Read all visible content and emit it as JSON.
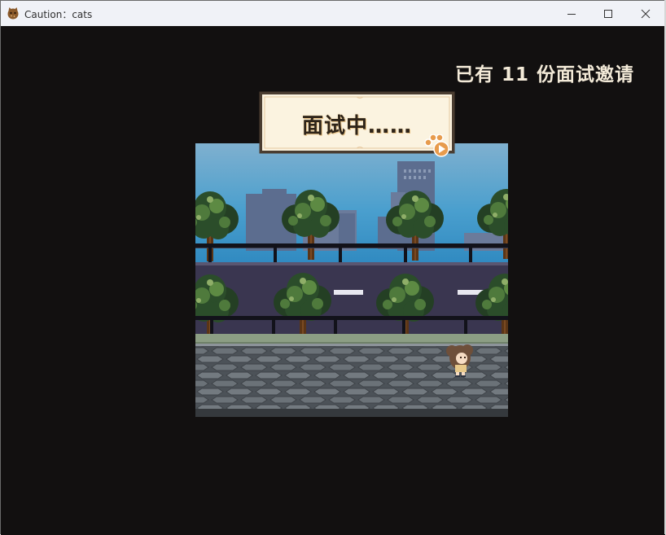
{
  "window": {
    "title": "Caution：cats",
    "app_icon": "cookie-cat-icon",
    "controls": {
      "minimize": "minimize-icon",
      "maximize": "maximize-icon",
      "close": "close-icon"
    }
  },
  "hud": {
    "interview_count_text": "已有 11 份面试邀请"
  },
  "banner": {
    "text": "面试中……",
    "icon": "paw-play-icon"
  },
  "colors": {
    "background": "#121010",
    "counter_text": "#f3ead8",
    "banner_fill": "#fbf3e0",
    "banner_border": "#4a3d31",
    "sky": "#3f9ac9",
    "road": "#3a3650",
    "pavement": "#6d7379"
  }
}
